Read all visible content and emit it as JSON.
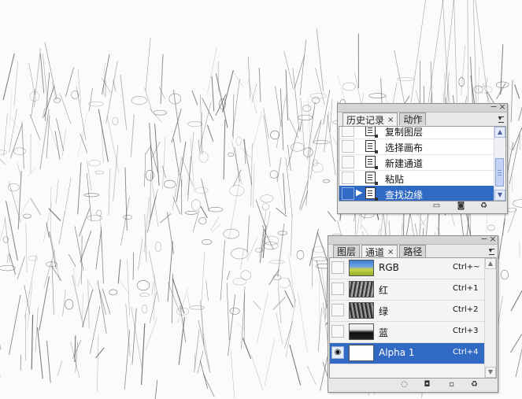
{
  "history_panel": {
    "tabs": [
      {
        "label": "历史记录",
        "close": "×"
      },
      {
        "label": "动作"
      }
    ],
    "steps": [
      {
        "label": "复制图层"
      },
      {
        "label": "选择画布"
      },
      {
        "label": "新建通道"
      },
      {
        "label": "粘贴"
      },
      {
        "label": "查找边缘",
        "selected": true
      }
    ],
    "footer_icons": [
      "new-document-from-state-icon",
      "new-snapshot-icon",
      "delete-icon"
    ]
  },
  "channels_panel": {
    "tabs": [
      {
        "label": "图层"
      },
      {
        "label": "通道",
        "close": "×"
      },
      {
        "label": "路径"
      }
    ],
    "channels": [
      {
        "name": "RGB",
        "shortcut": "Ctrl+~",
        "visible": false
      },
      {
        "name": "红",
        "shortcut": "Ctrl+1",
        "visible": false
      },
      {
        "name": "绿",
        "shortcut": "Ctrl+2",
        "visible": false
      },
      {
        "name": "蓝",
        "shortcut": "Ctrl+3",
        "visible": false
      },
      {
        "name": "Alpha 1",
        "shortcut": "Ctrl+4",
        "visible": true,
        "selected": true
      }
    ],
    "footer_icons": [
      "load-selection-icon",
      "save-selection-icon",
      "new-channel-icon",
      "delete-icon"
    ]
  },
  "window_buttons": {
    "minimize": "−",
    "close": "×"
  },
  "colors": {
    "selection": "#316ac5",
    "panel_bg": "#e8e8e6"
  }
}
